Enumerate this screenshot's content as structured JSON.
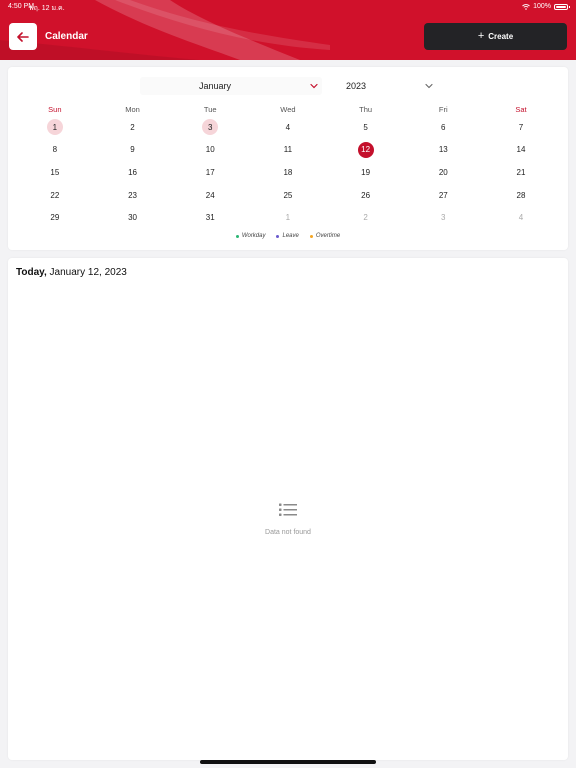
{
  "status_bar": {
    "time": "4:50 PM",
    "date": "พฤ. 12 ม.ค.",
    "battery": "100%"
  },
  "header": {
    "title": "Calendar",
    "create_label": "Create"
  },
  "calendar": {
    "month": "January",
    "year": "2023",
    "weekdays": [
      "Sun",
      "Mon",
      "Tue",
      "Wed",
      "Thu",
      "Fri",
      "Sat"
    ],
    "weeks": [
      [
        {
          "d": "1",
          "t": "holiday"
        },
        {
          "d": "2",
          "t": ""
        },
        {
          "d": "3",
          "t": "holiday"
        },
        {
          "d": "4",
          "t": ""
        },
        {
          "d": "5",
          "t": ""
        },
        {
          "d": "6",
          "t": ""
        },
        {
          "d": "7",
          "t": ""
        }
      ],
      [
        {
          "d": "8",
          "t": ""
        },
        {
          "d": "9",
          "t": ""
        },
        {
          "d": "10",
          "t": ""
        },
        {
          "d": "11",
          "t": ""
        },
        {
          "d": "12",
          "t": "today"
        },
        {
          "d": "13",
          "t": ""
        },
        {
          "d": "14",
          "t": ""
        }
      ],
      [
        {
          "d": "15",
          "t": ""
        },
        {
          "d": "16",
          "t": ""
        },
        {
          "d": "17",
          "t": ""
        },
        {
          "d": "18",
          "t": ""
        },
        {
          "d": "19",
          "t": ""
        },
        {
          "d": "20",
          "t": ""
        },
        {
          "d": "21",
          "t": ""
        }
      ],
      [
        {
          "d": "22",
          "t": ""
        },
        {
          "d": "23",
          "t": ""
        },
        {
          "d": "24",
          "t": ""
        },
        {
          "d": "25",
          "t": ""
        },
        {
          "d": "26",
          "t": ""
        },
        {
          "d": "27",
          "t": ""
        },
        {
          "d": "28",
          "t": ""
        }
      ],
      [
        {
          "d": "29",
          "t": ""
        },
        {
          "d": "30",
          "t": ""
        },
        {
          "d": "31",
          "t": ""
        },
        {
          "d": "1",
          "t": "other"
        },
        {
          "d": "2",
          "t": "other"
        },
        {
          "d": "3",
          "t": "other"
        },
        {
          "d": "4",
          "t": "other"
        }
      ]
    ],
    "legend": [
      {
        "label": "Workday",
        "color": "#2bb673"
      },
      {
        "label": "Leave",
        "color": "#6a5acd"
      },
      {
        "label": "Overtime",
        "color": "#f5a623"
      }
    ]
  },
  "today_panel": {
    "prefix": "Today,",
    "date": "January 12, 2023",
    "empty_text": "Data not found"
  },
  "colors": {
    "brand_red": "#d0112b",
    "create_bg": "#232326",
    "today_circle": "#c4102c",
    "holiday_circle": "#f6d5d9"
  },
  "icons": {
    "back": "arrow-left-icon",
    "create": "plus-icon",
    "dropdown": "chevron-down-icon",
    "empty": "list-icon"
  }
}
